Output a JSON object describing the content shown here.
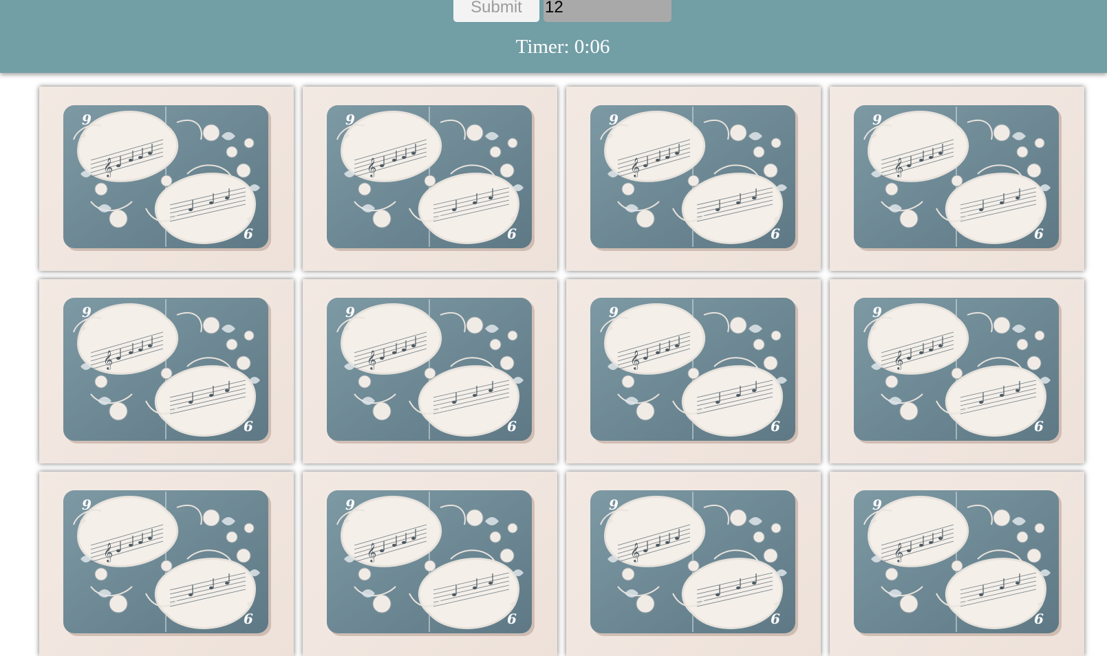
{
  "controls": {
    "submit_label": "Submit",
    "pairs_value": "12"
  },
  "timer": {
    "label": "Timer:",
    "value": "0:06"
  },
  "board": {
    "card_count": 12,
    "card_back": {
      "corner_top": "9",
      "corner_bottom": "6",
      "motif": "music-floral-card-back",
      "colors": {
        "card_bg": "#f1e6df",
        "panel": "#6f8d99",
        "oval": "#f4efe9",
        "ink": "#4e5b63"
      }
    }
  },
  "colors": {
    "header": "#729ea5",
    "submit_bg": "#f3f3f3",
    "submit_text": "#9c9c9c",
    "input_bg": "#a9a9a9",
    "timer_text": "#ffffff"
  }
}
